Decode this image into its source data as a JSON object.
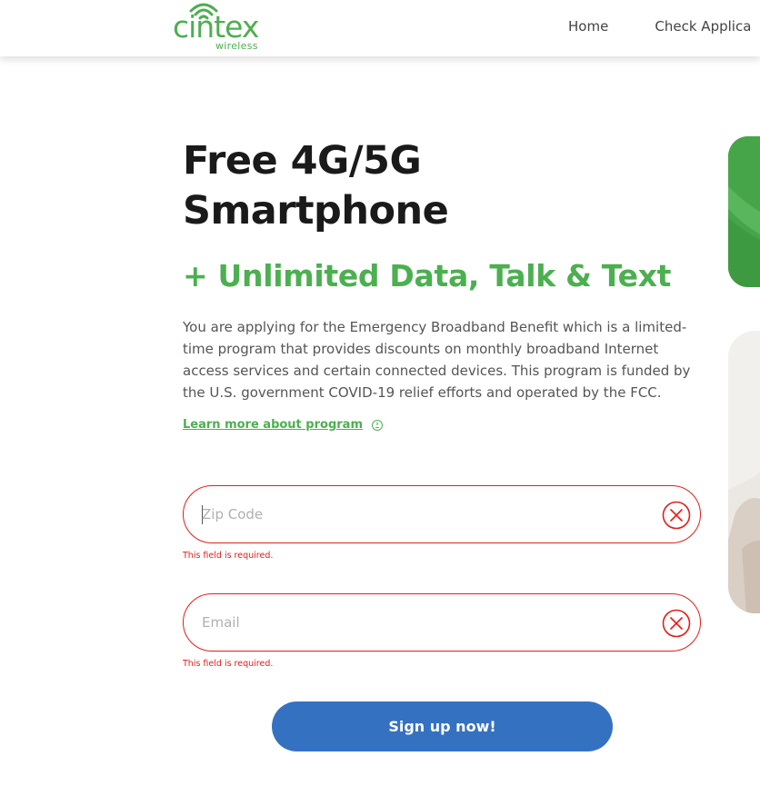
{
  "header": {
    "logo_text": "cintex",
    "logo_sub": "wireless",
    "nav": [
      {
        "label": "Home"
      },
      {
        "label": "Check Applica"
      }
    ]
  },
  "hero": {
    "title_line1": "Free 4G/5G",
    "title_line2": "Smartphone",
    "subtitle": "+ Unlimited Data, Talk & Text",
    "description": "You are applying for the Emergency Broadband Benefit which is a limited-time program that provides discounts on monthly broadband Internet access services and certain connected devices. This program is funded by the U.S. government COVID-19 relief efforts and operated by the FCC.",
    "learn_more": "Learn more about program"
  },
  "form": {
    "zip": {
      "placeholder": "Zip Code",
      "value": "",
      "error": "This field is required."
    },
    "email": {
      "placeholder": "Email",
      "value": "",
      "error": "This field is required."
    },
    "submit_label": "Sign up now!"
  },
  "colors": {
    "brand_green": "#4caf50",
    "error_red": "#e0201c",
    "button_blue": "#3571c1"
  },
  "icons": [
    "wifi-icon",
    "arrow-circle-icon",
    "error-x-icon"
  ]
}
